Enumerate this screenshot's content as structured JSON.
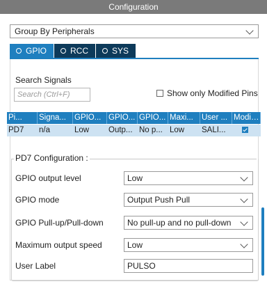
{
  "window": {
    "title": "Configuration"
  },
  "groupby": {
    "value": "Group By Peripherals"
  },
  "tabs": [
    {
      "label": "GPIO",
      "active": true
    },
    {
      "label": "RCC",
      "active": false
    },
    {
      "label": "SYS",
      "active": false
    }
  ],
  "search": {
    "label": "Search Signals",
    "placeholder": "Search (Ctrl+F)",
    "modified_label": "Show only Modified Pins"
  },
  "table": {
    "headers": [
      "Pi...",
      "Signa...",
      "GPIO...",
      "GPIO...",
      "GPIO...",
      "Maxi...",
      "User ...",
      "Modifi..."
    ],
    "rows": [
      [
        "PD7",
        "n/a",
        "Low",
        "Outp...",
        "No p...",
        "Low",
        "SALI...",
        ""
      ]
    ]
  },
  "pd7": {
    "title": "PD7 Configuration :",
    "rows": [
      {
        "label": "GPIO output level",
        "value": "Low"
      },
      {
        "label": "GPIO mode",
        "value": "Output Push Pull"
      },
      {
        "label": "GPIO Pull-up/Pull-down",
        "value": "No pull-up and no pull-down"
      },
      {
        "label": "Maximum output speed",
        "value": "Low"
      },
      {
        "label": "User Label",
        "value": "PULSO"
      }
    ]
  },
  "colors": {
    "accent": "#1f7fbf",
    "tab_inactive": "#0d3a5a",
    "title_bar": "#7a7a7a",
    "row_selected": "#cde2f2"
  }
}
